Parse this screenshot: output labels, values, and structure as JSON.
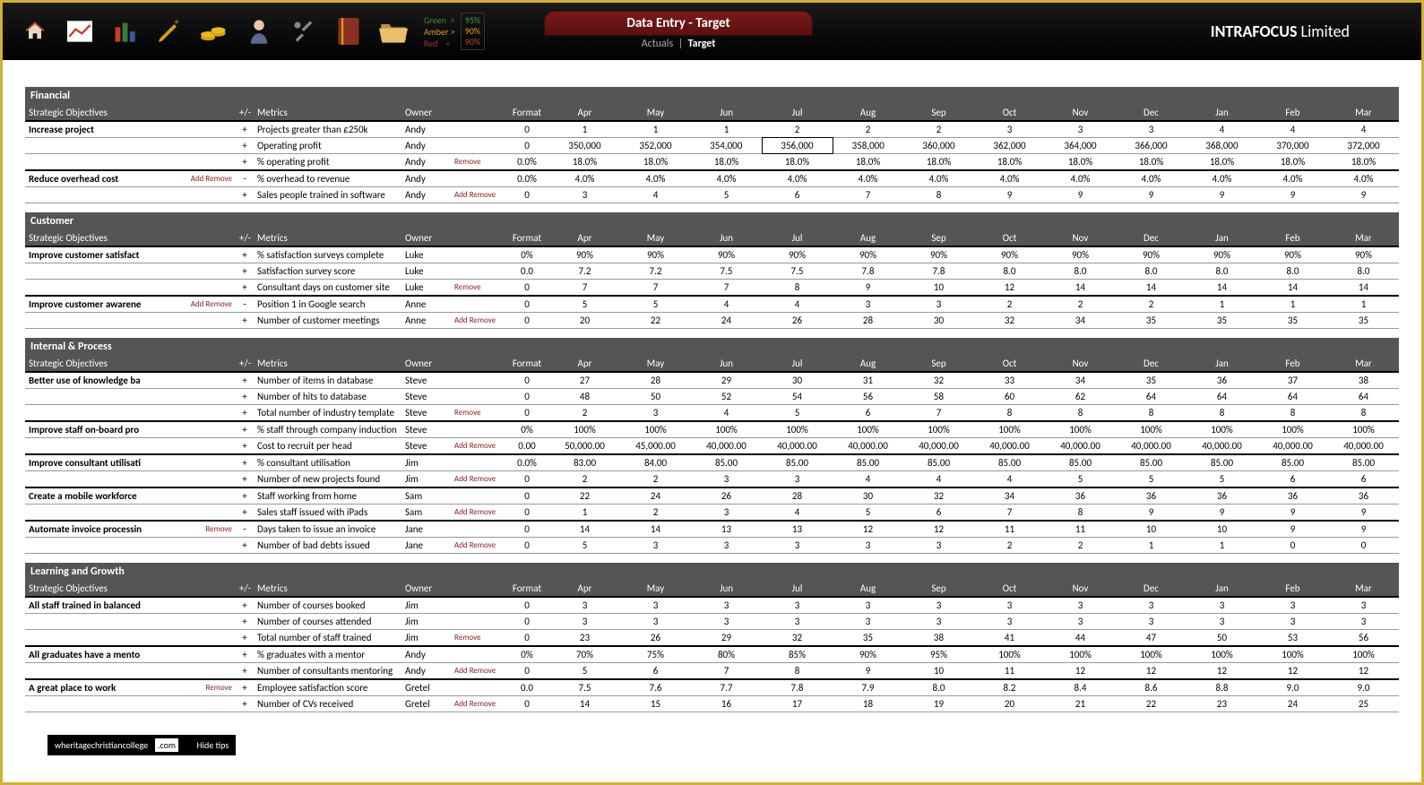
{
  "rag": {
    "green_label": "Green",
    "amber_label": "Amber",
    "red_label": "Red",
    "gt": ">",
    "lt": "<",
    "green_val": "95%",
    "amber_val": "90%",
    "red_val": "90%"
  },
  "title": {
    "main": "Data Entry - Target",
    "sub_actuals": "Actuals",
    "sub_sep": "|",
    "sub_target": "Target"
  },
  "brand": {
    "name": "INTRAFOCUS",
    "suffix": " Limited"
  },
  "months": [
    "Apr",
    "May",
    "Jun",
    "Jul",
    "Aug",
    "Sep",
    "Oct",
    "Nov",
    "Dec",
    "Jan",
    "Feb",
    "Mar"
  ],
  "headers": {
    "obj": "Strategic Objectives",
    "pm": "+/-",
    "met": "Metrics",
    "own": "Owner",
    "fmt": "Format"
  },
  "labels": {
    "add": "Add",
    "remove": "Remove",
    "plus": "+",
    "minus": "-"
  },
  "sections": [
    {
      "title": "Financial",
      "rows": [
        {
          "sep": true,
          "obj": "Increase project",
          "pm": "+",
          "met": "Projects greater than £250k",
          "own": "Andy",
          "ra": "",
          "fmt": "0",
          "vals": [
            "1",
            "1",
            "1",
            "2",
            "2",
            "2",
            "3",
            "3",
            "3",
            "4",
            "4",
            "4"
          ]
        },
        {
          "pm": "+",
          "met": "Operating profit",
          "own": "Andy",
          "ra": "",
          "fmt": "0",
          "vals": [
            "350,000",
            "352,000",
            "354,000",
            "356,000",
            "358,000",
            "360,000",
            "362,000",
            "364,000",
            "366,000",
            "368,000",
            "370,000",
            "372,000"
          ],
          "sel": 3
        },
        {
          "pm": "+",
          "met": "% operating profit",
          "own": "Andy",
          "ra": "Remove",
          "fmt": "0.0%",
          "vals": [
            "18.0%",
            "18.0%",
            "18.0%",
            "18.0%",
            "18.0%",
            "18.0%",
            "18.0%",
            "18.0%",
            "18.0%",
            "18.0%",
            "18.0%",
            "18.0%"
          ]
        },
        {
          "sep": true,
          "obj": "Reduce overhead cost",
          "obj_act": "Add  Remove",
          "pm": "-",
          "met": "% overhead to revenue",
          "own": "Andy",
          "ra": "",
          "fmt": "0.0%",
          "vals": [
            "4.0%",
            "4.0%",
            "4.0%",
            "4.0%",
            "4.0%",
            "4.0%",
            "4.0%",
            "4.0%",
            "4.0%",
            "4.0%",
            "4.0%",
            "4.0%"
          ]
        },
        {
          "pm": "+",
          "met": "Sales people trained in software",
          "own": "Andy",
          "ra": "Add  Remove",
          "fmt": "0",
          "vals": [
            "3",
            "4",
            "5",
            "6",
            "7",
            "8",
            "9",
            "9",
            "9",
            "9",
            "9",
            "9"
          ]
        }
      ]
    },
    {
      "title": "Customer",
      "rows": [
        {
          "sep": true,
          "obj": "Improve customer satisfact",
          "pm": "+",
          "met": "% satisfaction surveys complete",
          "own": "Luke",
          "ra": "",
          "fmt": "0%",
          "vals": [
            "90%",
            "90%",
            "90%",
            "90%",
            "90%",
            "90%",
            "90%",
            "90%",
            "90%",
            "90%",
            "90%",
            "90%"
          ]
        },
        {
          "pm": "+",
          "met": "Satisfaction survey score",
          "own": "Luke",
          "ra": "",
          "fmt": "0.0",
          "vals": [
            "7.2",
            "7.2",
            "7.5",
            "7.5",
            "7.8",
            "7.8",
            "8.0",
            "8.0",
            "8.0",
            "8.0",
            "8.0",
            "8.0"
          ]
        },
        {
          "pm": "+",
          "met": "Consultant days on customer site",
          "own": "Luke",
          "ra": "Remove",
          "fmt": "0",
          "vals": [
            "7",
            "7",
            "7",
            "8",
            "9",
            "10",
            "12",
            "14",
            "14",
            "14",
            "14",
            "14"
          ]
        },
        {
          "sep": true,
          "obj": "Improve customer awarene",
          "obj_act": "Add  Remove",
          "pm": "-",
          "met": "Position 1 in Google search",
          "own": "Anne",
          "ra": "",
          "fmt": "0",
          "vals": [
            "5",
            "5",
            "4",
            "4",
            "3",
            "3",
            "2",
            "2",
            "2",
            "1",
            "1",
            "1"
          ]
        },
        {
          "pm": "+",
          "met": "Number of customer meetings",
          "own": "Anne",
          "ra": "Add  Remove",
          "fmt": "0",
          "vals": [
            "20",
            "22",
            "24",
            "26",
            "28",
            "30",
            "32",
            "34",
            "35",
            "35",
            "35",
            "35"
          ]
        }
      ]
    },
    {
      "title": "Internal & Process",
      "rows": [
        {
          "sep": true,
          "obj": "Better use of knowledge ba",
          "pm": "+",
          "met": "Number of items in database",
          "own": "Steve",
          "ra": "",
          "fmt": "0",
          "vals": [
            "27",
            "28",
            "29",
            "30",
            "31",
            "32",
            "33",
            "34",
            "35",
            "36",
            "37",
            "38"
          ]
        },
        {
          "pm": "+",
          "met": "Number of hits to database",
          "own": "Steve",
          "ra": "",
          "fmt": "0",
          "vals": [
            "48",
            "50",
            "52",
            "54",
            "56",
            "58",
            "60",
            "62",
            "64",
            "64",
            "64",
            "64"
          ]
        },
        {
          "pm": "+",
          "met": "Total number of industry template",
          "own": "Steve",
          "ra": "Remove",
          "fmt": "0",
          "vals": [
            "2",
            "3",
            "4",
            "5",
            "6",
            "7",
            "8",
            "8",
            "8",
            "8",
            "8",
            "8"
          ]
        },
        {
          "sep": true,
          "obj": "Improve staff on-board pro",
          "pm": "+",
          "met": "% staff through company induction",
          "own": "Steve",
          "ra": "",
          "fmt": "0%",
          "vals": [
            "100%",
            "100%",
            "100%",
            "100%",
            "100%",
            "100%",
            "100%",
            "100%",
            "100%",
            "100%",
            "100%",
            "100%"
          ]
        },
        {
          "pm": "+",
          "met": "Cost to recruit per head",
          "own": "Steve",
          "ra": "Add  Remove",
          "fmt": "0.00",
          "vals": [
            "50,000.00",
            "45,000.00",
            "40,000.00",
            "40,000.00",
            "40,000.00",
            "40,000.00",
            "40,000.00",
            "40,000.00",
            "40,000.00",
            "40,000.00",
            "40,000.00",
            "40,000.00"
          ]
        },
        {
          "sep": true,
          "obj": "Improve consultant utilisati",
          "pm": "+",
          "met": "% consultant utilisation",
          "own": "Jim",
          "ra": "",
          "fmt": "0.0%",
          "vals": [
            "83.00",
            "84.00",
            "85.00",
            "85.00",
            "85.00",
            "85.00",
            "85.00",
            "85.00",
            "85.00",
            "85.00",
            "85.00",
            "85.00"
          ]
        },
        {
          "pm": "+",
          "met": "Number of new projects found",
          "own": "Jim",
          "ra": "Add  Remove",
          "fmt": "0",
          "vals": [
            "2",
            "2",
            "3",
            "3",
            "4",
            "4",
            "4",
            "5",
            "5",
            "5",
            "6",
            "6"
          ]
        },
        {
          "sep": true,
          "obj": "Create a mobile workforce",
          "pm": "+",
          "met": "Staff working from home",
          "own": "Sam",
          "ra": "",
          "fmt": "0",
          "vals": [
            "22",
            "24",
            "26",
            "28",
            "30",
            "32",
            "34",
            "36",
            "36",
            "36",
            "36",
            "36"
          ]
        },
        {
          "pm": "+",
          "met": "Sales staff issued with iPads",
          "own": "Sam",
          "ra": "Add  Remove",
          "fmt": "0",
          "vals": [
            "1",
            "2",
            "3",
            "4",
            "5",
            "6",
            "7",
            "8",
            "9",
            "9",
            "9",
            "9"
          ]
        },
        {
          "sep": true,
          "obj": "Automate invoice processin",
          "obj_act": "Remove",
          "pm": "-",
          "met": "Days taken to issue an invoice",
          "own": "Jane",
          "ra": "",
          "fmt": "0",
          "vals": [
            "14",
            "14",
            "13",
            "13",
            "12",
            "12",
            "11",
            "11",
            "10",
            "10",
            "9",
            "9"
          ]
        },
        {
          "pm": "+",
          "met": "Number of bad debts issued",
          "own": "Jane",
          "ra": "Add  Remove",
          "fmt": "0",
          "vals": [
            "5",
            "3",
            "3",
            "3",
            "3",
            "3",
            "2",
            "2",
            "1",
            "1",
            "0",
            "0"
          ]
        }
      ]
    },
    {
      "title": "Learning and Growth",
      "rows": [
        {
          "sep": true,
          "obj": "All staff trained in balanced",
          "pm": "+",
          "met": "Number of courses booked",
          "own": "Jim",
          "ra": "",
          "fmt": "0",
          "vals": [
            "3",
            "3",
            "3",
            "3",
            "3",
            "3",
            "3",
            "3",
            "3",
            "3",
            "3",
            "3"
          ]
        },
        {
          "pm": "+",
          "met": "Number of courses attended",
          "own": "Jim",
          "ra": "",
          "fmt": "0",
          "vals": [
            "3",
            "3",
            "3",
            "3",
            "3",
            "3",
            "3",
            "3",
            "3",
            "3",
            "3",
            "3"
          ]
        },
        {
          "pm": "+",
          "met": "Total number of staff trained",
          "own": "Jim",
          "ra": "Remove",
          "fmt": "0",
          "vals": [
            "23",
            "26",
            "29",
            "32",
            "35",
            "38",
            "41",
            "44",
            "47",
            "50",
            "53",
            "56"
          ]
        },
        {
          "sep": true,
          "obj": "All graduates have a mento",
          "pm": "+",
          "met": "% graduates with a mentor",
          "own": "Andy",
          "ra": "",
          "fmt": "0%",
          "vals": [
            "70%",
            "75%",
            "80%",
            "85%",
            "90%",
            "95%",
            "100%",
            "100%",
            "100%",
            "100%",
            "100%",
            "100%"
          ]
        },
        {
          "pm": "+",
          "met": "Number of consultants mentoring",
          "own": "Andy",
          "ra": "Add  Remove",
          "fmt": "0",
          "vals": [
            "5",
            "6",
            "7",
            "8",
            "9",
            "10",
            "11",
            "12",
            "12",
            "12",
            "12",
            "12"
          ]
        },
        {
          "sep": true,
          "obj": "A great place to work",
          "obj_act": "Remove",
          "pm": "+",
          "met": "Employee satisfaction score",
          "own": "Gretel",
          "ra": "",
          "fmt": "0.0",
          "vals": [
            "7.5",
            "7.6",
            "7.7",
            "7.8",
            "7.9",
            "8.0",
            "8.2",
            "8.4",
            "8.6",
            "8.8",
            "9.0",
            "9.0"
          ]
        },
        {
          "pm": "+",
          "met": "Number of CVs received",
          "own": "Gretel",
          "ra": "Add  Remove",
          "fmt": "0",
          "vals": [
            "14",
            "15",
            "16",
            "17",
            "18",
            "19",
            "20",
            "21",
            "22",
            "23",
            "24",
            "25"
          ]
        }
      ]
    }
  ],
  "footer": {
    "text1": "wheritagechristiancollege",
    "text2": ".com",
    "text3": "Hide tips"
  }
}
